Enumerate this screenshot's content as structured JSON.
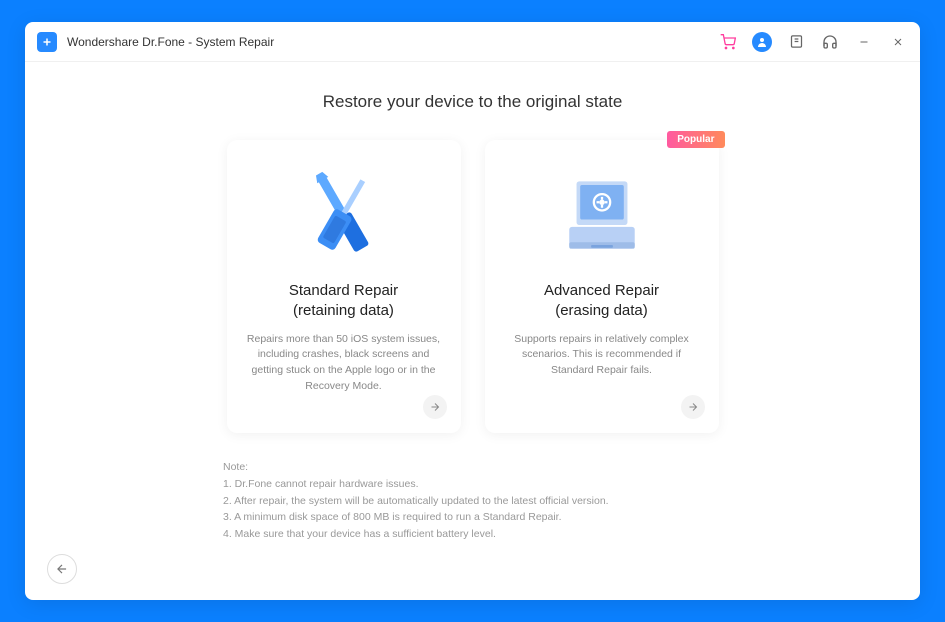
{
  "titlebar": {
    "title": "Wondershare Dr.Fone - System Repair"
  },
  "page": {
    "heading": "Restore your device to the original state"
  },
  "cards": {
    "standard": {
      "title_line1": "Standard Repair",
      "title_line2": "(retaining data)",
      "desc": "Repairs more than 50 iOS system issues, including crashes, black screens and getting stuck on the Apple logo or in the Recovery Mode."
    },
    "advanced": {
      "badge": "Popular",
      "title_line1": "Advanced Repair",
      "title_line2": "(erasing data)",
      "desc": "Supports repairs in relatively complex scenarios. This is recommended if Standard Repair fails."
    }
  },
  "notes": {
    "heading": "Note:",
    "line1": "1. Dr.Fone cannot repair hardware issues.",
    "line2": "2. After repair, the system will be automatically updated to the latest official version.",
    "line3": "3. A minimum disk space of 800 MB is required to run a Standard Repair.",
    "line4": "4. Make sure that your device has a sufficient battery level."
  }
}
